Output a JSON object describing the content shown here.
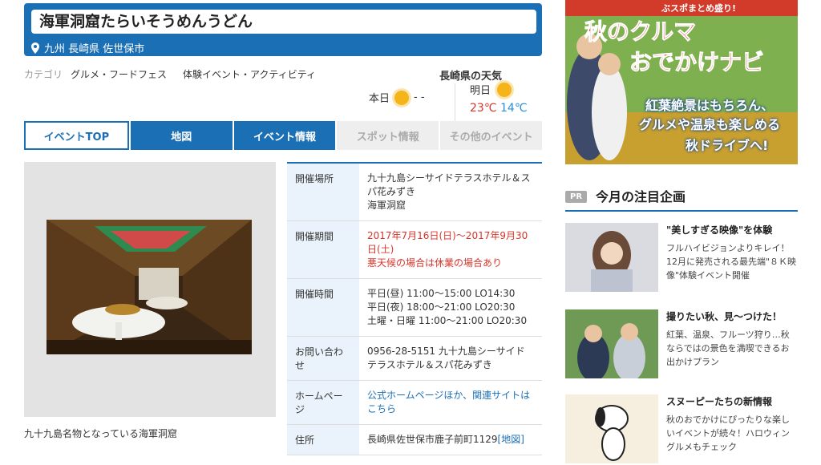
{
  "event": {
    "title": "海軍洞窟たらいそうめんうどん",
    "location": "九州 長崎県 佐世保市"
  },
  "category": {
    "label": "カテゴリ",
    "values": [
      "グルメ・フードフェス",
      "体験イベント・アクティビティ"
    ]
  },
  "weather": {
    "title": "長崎県の天気",
    "today_label": "本日",
    "today_temp": "- -",
    "tomorrow_label": "明日",
    "tomorrow_high": "23℃",
    "tomorrow_low": "14℃"
  },
  "tabs": [
    {
      "label": "イベントTOP"
    },
    {
      "label": "地図"
    },
    {
      "label": "イベント情報"
    },
    {
      "label": "スポット情報"
    },
    {
      "label": "その他のイベント"
    }
  ],
  "photo_caption": "九十九島名物となっている海軍洞窟",
  "info": {
    "venue_label": "開催場所",
    "venue_value": "九十九島シーサイドテラスホテル＆スパ花みずき\n海軍洞窟",
    "period_label": "開催期間",
    "period_value": "2017年7月16日(日)〜2017年9月30日(土)",
    "period_note": "悪天候の場合は休業の場合あり",
    "hours_label": "開催時間",
    "hours_value": "平日(昼) 11:00〜15:00 LO14:30\n平日(夜) 18:00〜21:00 LO20:30\n土曜・日曜 11:00〜21:00 LO20:30",
    "contact_label": "お問い合わせ",
    "contact_value": "0956-28-5151 九十九島シーサイドテラスホテル＆スパ花みずき",
    "homepage_label": "ホームページ",
    "homepage_value": "公式ホームページほか、関連サイトはこちら",
    "address_label": "住所",
    "address_value": "長崎県佐世保市鹿子前町1129",
    "address_map": "[地図]"
  },
  "banner": {
    "line1": "秋のクルマ",
    "line2": "おでかけナビ",
    "top": "ぶスポまとめ盛り!",
    "sub1": "紅葉絶景はもちろん、",
    "sub2": "グルメや温泉も楽しめる",
    "sub3": "秋ドライブへ!"
  },
  "pr": {
    "badge": "PR",
    "title": "今月の注目企画",
    "items": [
      {
        "title": "\"美しすぎる映像\"を体験",
        "desc": "フルハイビジョンよりキレイ！12月に発売される最先端\"８Ｋ映像\"体験イベント開催"
      },
      {
        "title": "撮りたい秋、見〜つけた！",
        "desc": "紅葉、温泉、フルーツ狩り…秋ならではの景色を満喫できるお出かけプラン"
      },
      {
        "title": "スヌーピーたちの新情報",
        "desc": "秋のおでかけにぴったりな楽しいイベントが続々！ハロウィングルメもチェック"
      }
    ]
  }
}
